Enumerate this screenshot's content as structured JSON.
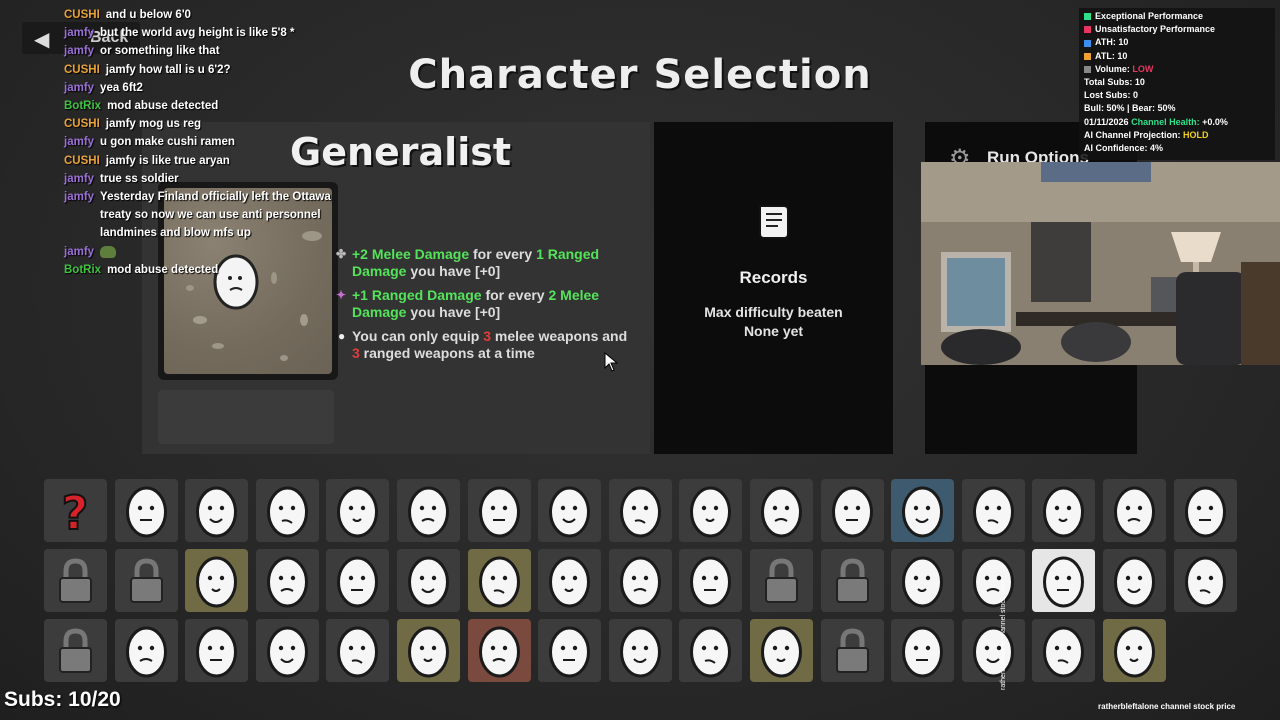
{
  "back_button": {
    "label": "Back"
  },
  "title": "Character Selection",
  "chat": [
    {
      "user": "CUSHI",
      "color": "cushi",
      "text": "and u below 6'0"
    },
    {
      "user": "jamfy",
      "color": "jamfy",
      "text": "but the world avg height is like 5'8 *"
    },
    {
      "user": "jamfy",
      "color": "jamfy",
      "text": "or something like that"
    },
    {
      "user": "CUSHI",
      "color": "cushi",
      "text": "jamfy how tall is u 6'2?"
    },
    {
      "user": "jamfy",
      "color": "jamfy",
      "text": "yea 6ft2"
    },
    {
      "user": "BotRix",
      "color": "bot",
      "text": "mod abuse detected"
    },
    {
      "user": "CUSHI",
      "color": "cushi",
      "text": "jamfy mog us reg"
    },
    {
      "user": "jamfy",
      "color": "jamfy",
      "text": "u gon make cushi ramen"
    },
    {
      "user": "CUSHI",
      "color": "cushi",
      "text": "jamfy is like true aryan"
    },
    {
      "user": "jamfy",
      "color": "jamfy",
      "text": "true ss soldier"
    },
    {
      "user": "jamfy",
      "color": "jamfy",
      "text": "Yesterday Finland officially left the Ottawa treaty so now we can use anti personnel landmines and blow mfs up"
    },
    {
      "user": "jamfy",
      "color": "jamfy",
      "text": "",
      "emote": true
    },
    {
      "user": "BotRix",
      "color": "bot",
      "text": "mod abuse detected"
    }
  ],
  "character": {
    "name": "Generalist",
    "bonuses": [
      {
        "icon": "sword-icon",
        "parts": [
          [
            "+2 Melee Damage",
            "green"
          ],
          [
            " for every ",
            "gray"
          ],
          [
            "1 Ranged Damage",
            "green"
          ],
          [
            " you have [+0]",
            "gray"
          ]
        ]
      },
      {
        "icon": "bow-icon",
        "parts": [
          [
            "+1 Ranged Damage",
            "green"
          ],
          [
            " for every ",
            "gray"
          ],
          [
            "2 Melee Damage",
            "green"
          ],
          [
            " you have [+0]",
            "gray"
          ]
        ]
      },
      {
        "icon": "bullet-icon",
        "parts": [
          [
            "You can only equip ",
            "gray"
          ],
          [
            "3",
            "red"
          ],
          [
            " melee weapons and ",
            "gray"
          ],
          [
            "3",
            "red"
          ],
          [
            " ranged weapons at a time",
            "gray"
          ]
        ]
      }
    ]
  },
  "records": {
    "heading": "Records",
    "line1": "Max difficulty beaten",
    "line2": "None yet"
  },
  "run_options": {
    "label": "Run Options"
  },
  "stats": {
    "legend": [
      {
        "label": "Exceptional Performance",
        "color": "#2ee08a"
      },
      {
        "label": "Unsatisfactory Performance",
        "color": "#e8355f"
      }
    ],
    "ath": {
      "label": "ATH:",
      "value": "10",
      "color": "#3a8ef0"
    },
    "atl": {
      "label": "ATL:",
      "value": "10",
      "color": "#f0a030"
    },
    "volume": {
      "label": "Volume:",
      "value": "LOW",
      "color": "#888888"
    },
    "total_subs": "Total Subs: 10",
    "lost_subs": "Lost Subs: 0",
    "bull_bear": "Bull: 50% | Bear: 50%",
    "date": "01/11/2026",
    "health_label": "Channel Health:",
    "health_value": "+0.0%",
    "projection_label": "AI Channel Projection:",
    "projection_value": "HOLD",
    "confidence": "AI Confidence: 4%"
  },
  "subs_counter": "Subs: 10/20",
  "stock_caption": "ratherbleftalone channel stock price",
  "stock_caption_vertical": "ratherbleftalone channel stock price",
  "characters_grid": [
    [
      "random",
      "face",
      "face",
      "face",
      "face",
      "face",
      "face",
      "face",
      "face",
      "face",
      "face",
      "face",
      "face-selected",
      "face",
      "face",
      "face",
      "face"
    ],
    [
      "locked",
      "locked",
      "face-gold",
      "face",
      "face",
      "face",
      "face-gold",
      "face",
      "face",
      "face",
      "locked",
      "locked",
      "face",
      "face",
      "face-white",
      "face",
      "face"
    ],
    [
      "locked",
      "face",
      "face",
      "face",
      "face",
      "face-gold",
      "face-rust",
      "face",
      "face",
      "face",
      "face-gold",
      "locked",
      "face",
      "face",
      "face",
      "face-gold"
    ]
  ]
}
